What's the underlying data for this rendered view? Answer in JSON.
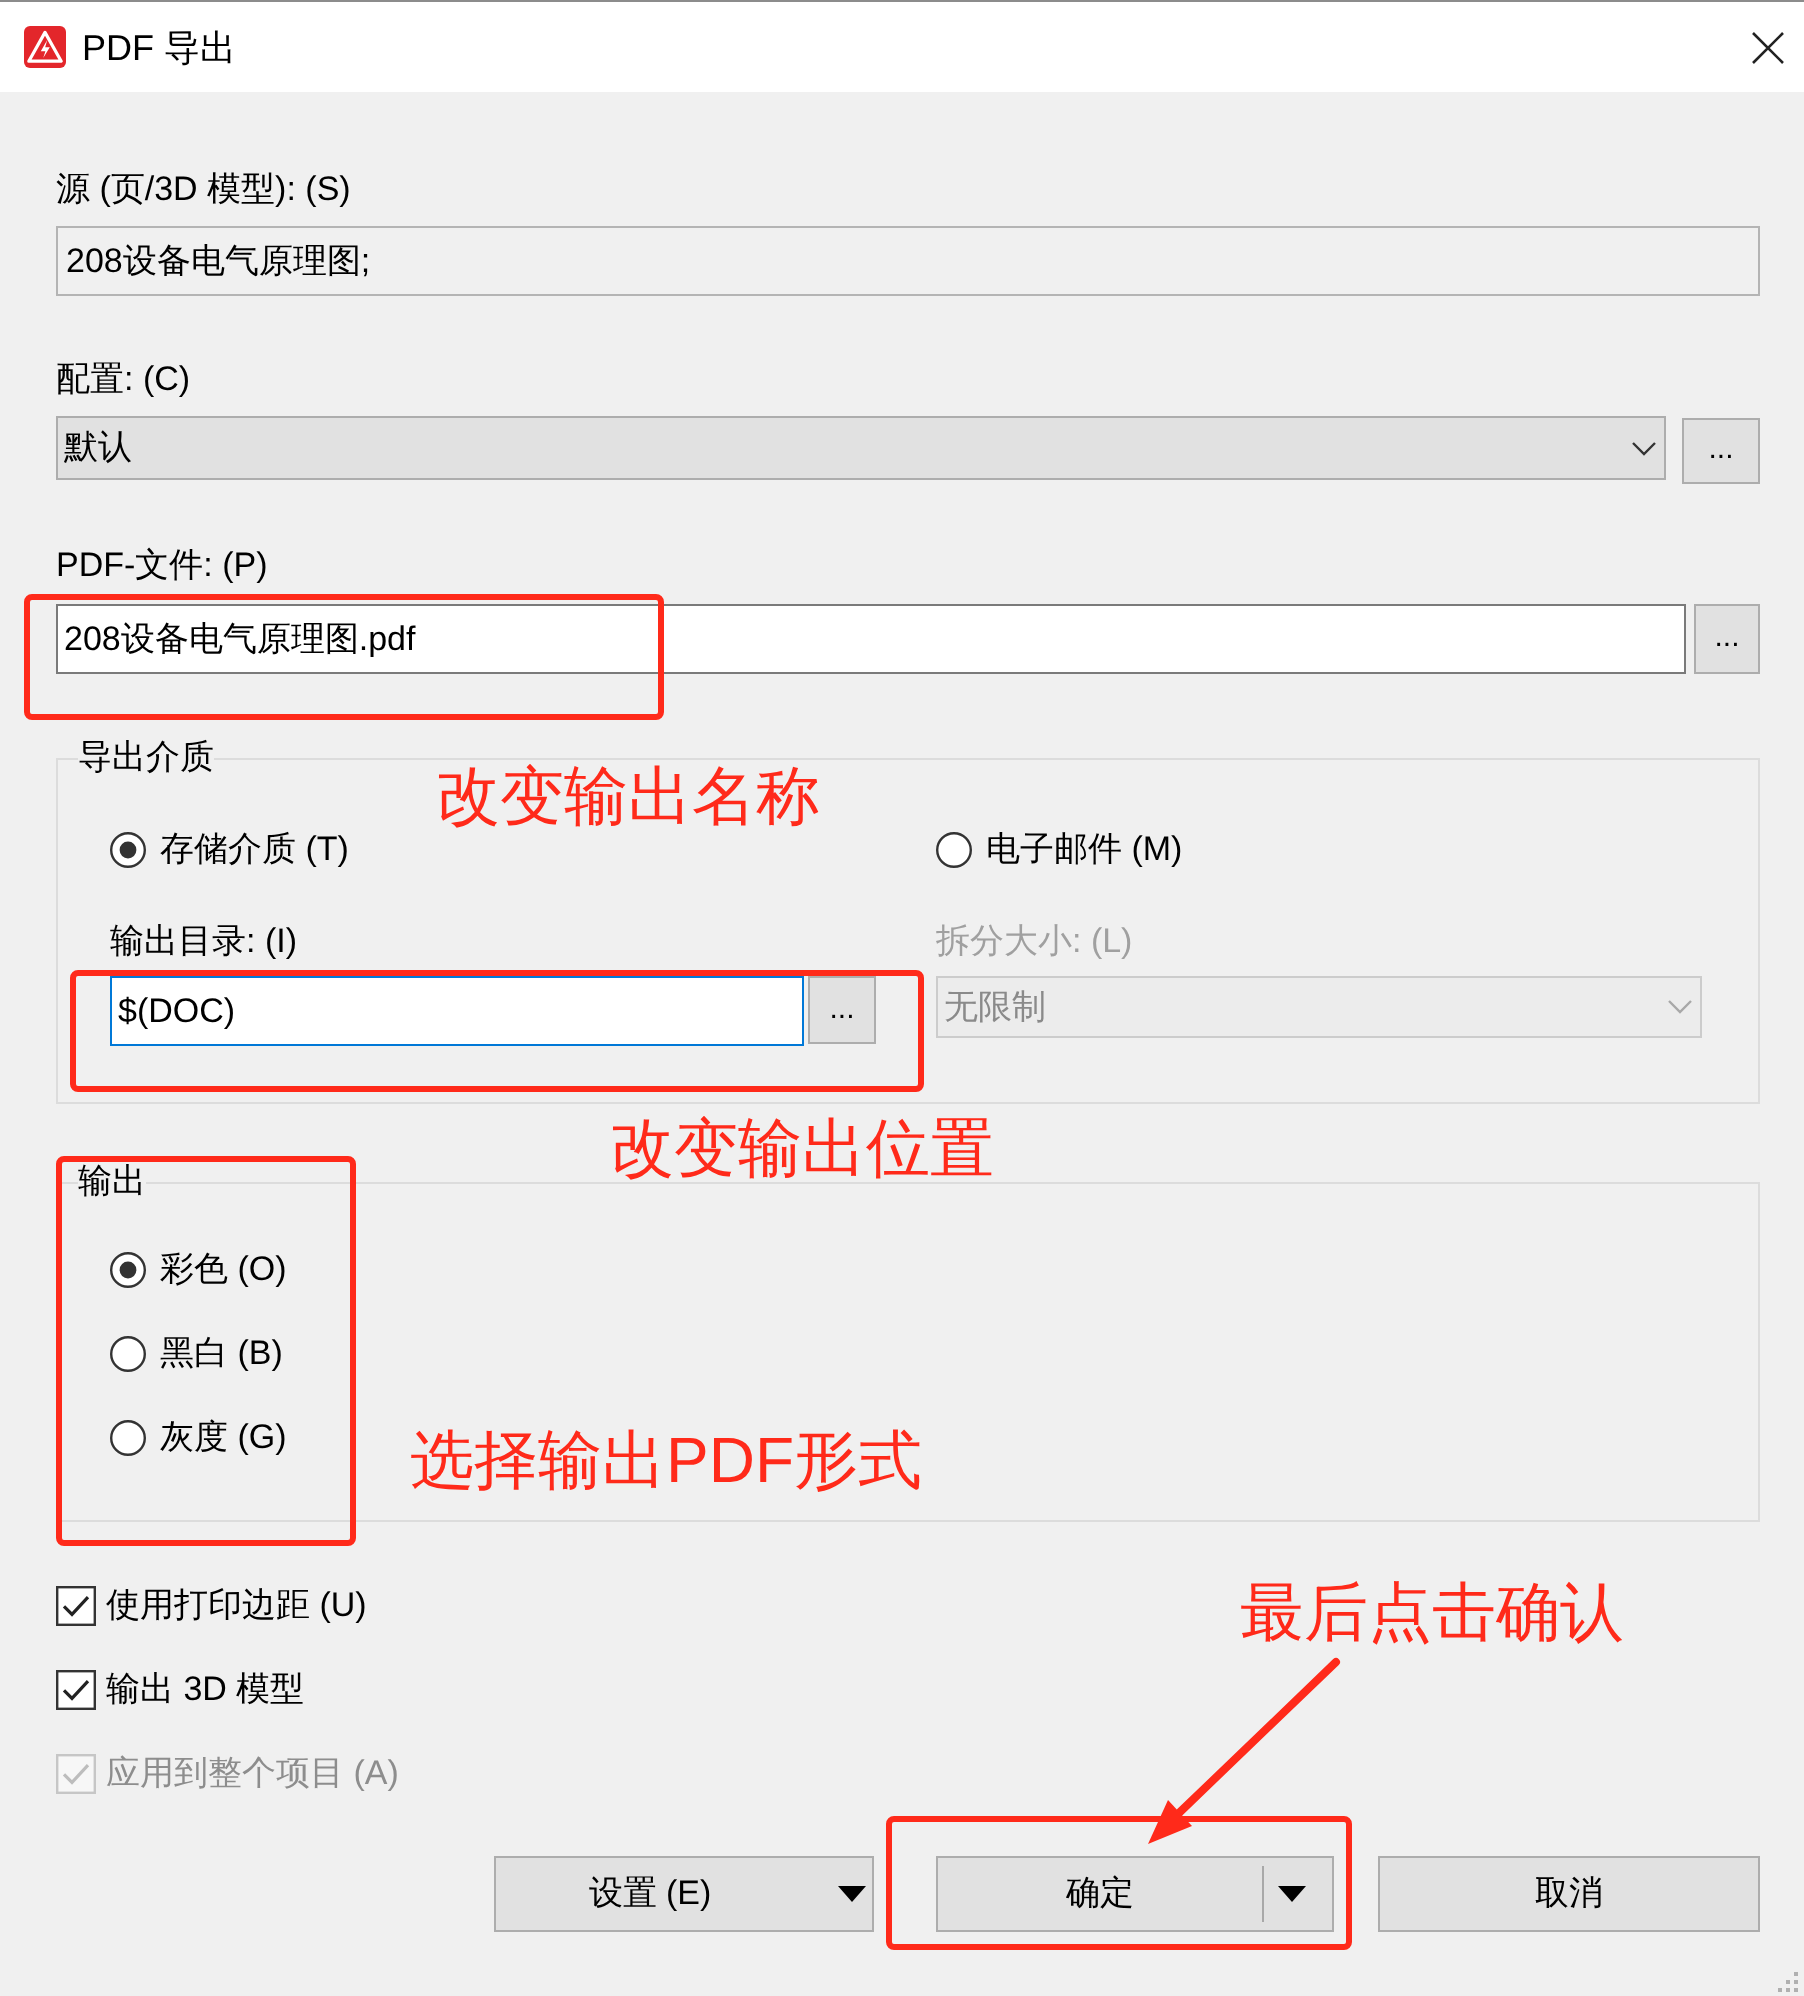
{
  "window": {
    "title": "PDF 导出"
  },
  "source": {
    "label": "源 (页/3D 模型): (S)",
    "value": "208设备电气原理图;",
    "read_only": true
  },
  "configuration": {
    "label": "配置: (C)",
    "value": "默认",
    "browse_button": "..."
  },
  "pdf_file": {
    "label": "PDF-文件: (P)",
    "value": "208设备电气原理图.pdf",
    "browse_button": "..."
  },
  "export_medium": {
    "title": "导出介质",
    "options": [
      {
        "label": "存储介质 (T)",
        "selected": true
      },
      {
        "label": "电子邮件 (M)",
        "selected": false
      }
    ],
    "output_directory": {
      "label": "输出目录: (I)",
      "value": "$(DOC)",
      "browse_button": "...",
      "focused": true
    },
    "split_size": {
      "label": "拆分大小: (L)",
      "value": "无限制",
      "disabled": true
    }
  },
  "output": {
    "title": "输出",
    "options": [
      {
        "label": "彩色 (O)",
        "selected": true
      },
      {
        "label": "黑白 (B)",
        "selected": false
      },
      {
        "label": "灰度 (G)",
        "selected": false
      }
    ]
  },
  "checkboxes": [
    {
      "label": "使用打印边距 (U)",
      "checked": true,
      "disabled": false
    },
    {
      "label": "输出 3D 模型",
      "checked": true,
      "disabled": false
    },
    {
      "label": "应用到整个项目 (A)",
      "checked": true,
      "disabled": true
    }
  ],
  "buttons": [
    {
      "label": "设置 (E)",
      "kind": "menu"
    },
    {
      "label": "确定",
      "kind": "split"
    },
    {
      "label": "取消",
      "kind": "plain"
    }
  ],
  "annotations": [
    {
      "kind": "box"
    },
    {
      "kind": "note",
      "text": "改变输出名称"
    },
    {
      "kind": "box"
    },
    {
      "kind": "note",
      "text": "改变输出位置"
    },
    {
      "kind": "box"
    },
    {
      "kind": "note",
      "text": "选择输出PDF形式"
    },
    {
      "kind": "note",
      "text": "最后点击确认"
    },
    {
      "kind": "box"
    },
    {
      "kind": "arrow"
    }
  ]
}
